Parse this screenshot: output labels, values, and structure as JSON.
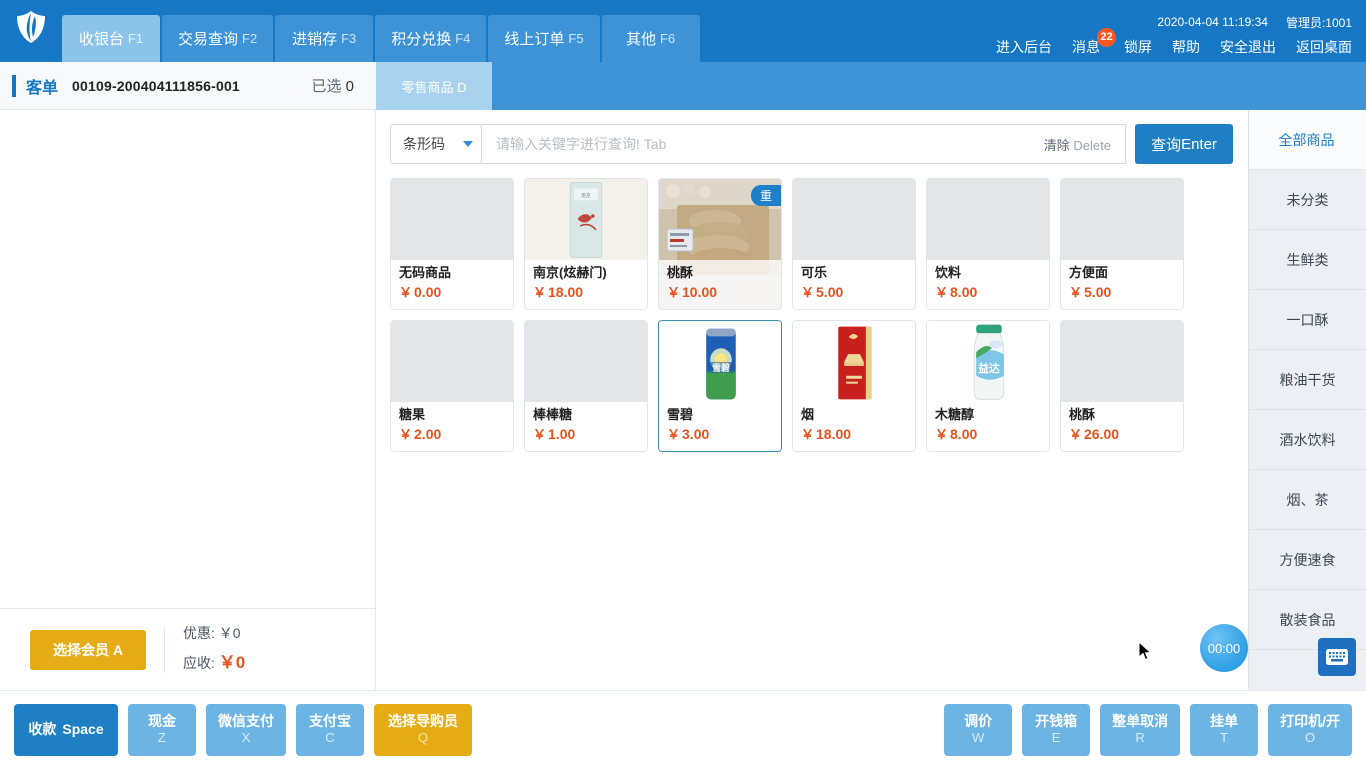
{
  "header": {
    "logo_icon": "shield-logo-icon",
    "tabs": [
      {
        "label": "收银台",
        "key": "F1",
        "active": true
      },
      {
        "label": "交易查询",
        "key": "F2",
        "active": false
      },
      {
        "label": "进销存",
        "key": "F3",
        "active": false
      },
      {
        "label": "积分兑换",
        "key": "F4",
        "active": false
      },
      {
        "label": "线上订单",
        "key": "F5",
        "active": false
      },
      {
        "label": "其他",
        "key": "F6",
        "active": false
      }
    ],
    "datetime": "2020-04-04 11:19:34",
    "operator": "管理员:1001",
    "links": [
      {
        "label": "进入后台",
        "name": "enter-backend"
      },
      {
        "label": "消息",
        "name": "messages",
        "badge": "22"
      },
      {
        "label": "锁屏",
        "name": "lock-screen"
      },
      {
        "label": "帮助",
        "name": "help"
      },
      {
        "label": "安全退出",
        "name": "safe-logout"
      },
      {
        "label": "返回桌面",
        "name": "back-to-desktop"
      }
    ]
  },
  "subheader": {
    "order_label": "客单",
    "order_no": "00109-200404111856-001",
    "selected_label": "已选",
    "selected_count": "0",
    "retail_tab": "零售商品 D"
  },
  "search": {
    "type_value": "条形码",
    "placeholder": "请输入关键字进行查询! Tab",
    "input_value": "",
    "clear_label": "清除",
    "clear_key": "Delete",
    "query_label": "查询",
    "query_key": "Enter"
  },
  "products": [
    {
      "name": "无码商品",
      "price": "0.00",
      "currency": "￥",
      "style": "blank",
      "badge": null,
      "selected": false,
      "image": null
    },
    {
      "name": "南京(炫赫门)",
      "price": "18.00",
      "currency": "￥",
      "style": "photo",
      "badge": null,
      "selected": false,
      "image": "cigarette-pack-teal"
    },
    {
      "name": "桃酥",
      "price": "10.00",
      "currency": "￥",
      "style": "fullbleed",
      "badge": "重",
      "selected": false,
      "image": "pastry-tray-photo"
    },
    {
      "name": "可乐",
      "price": "5.00",
      "currency": "￥",
      "style": "blank",
      "badge": null,
      "selected": false,
      "image": null
    },
    {
      "name": "饮料",
      "price": "8.00",
      "currency": "￥",
      "style": "blank",
      "badge": null,
      "selected": false,
      "image": null
    },
    {
      "name": "方便面",
      "price": "5.00",
      "currency": "￥",
      "style": "blank",
      "badge": null,
      "selected": false,
      "image": null
    },
    {
      "name": "糖果",
      "price": "2.00",
      "currency": "￥",
      "style": "blank",
      "badge": null,
      "selected": false,
      "image": null
    },
    {
      "name": "棒棒糖",
      "price": "1.00",
      "currency": "￥",
      "style": "blank",
      "badge": null,
      "selected": false,
      "image": null
    },
    {
      "name": "雪碧",
      "price": "3.00",
      "currency": "￥",
      "style": "photo",
      "badge": null,
      "selected": true,
      "image": "sprite-can"
    },
    {
      "name": "烟",
      "price": "18.00",
      "currency": "￥",
      "style": "photo",
      "badge": null,
      "selected": false,
      "image": "red-cigarette-pack"
    },
    {
      "name": "木糖醇",
      "price": "8.00",
      "currency": "￥",
      "style": "photo",
      "badge": null,
      "selected": false,
      "image": "xylitol-bottle"
    },
    {
      "name": "桃酥",
      "price": "26.00",
      "currency": "￥",
      "style": "blank",
      "badge": null,
      "selected": false,
      "image": null
    }
  ],
  "categories": [
    {
      "label": "全部商品",
      "active": true
    },
    {
      "label": "未分类",
      "active": false
    },
    {
      "label": "生鲜类",
      "active": false
    },
    {
      "label": "一口酥",
      "active": false
    },
    {
      "label": "粮油干货",
      "active": false
    },
    {
      "label": "酒水饮料",
      "active": false
    },
    {
      "label": "烟、茶",
      "active": false
    },
    {
      "label": "方便速食",
      "active": false
    },
    {
      "label": "散装食品",
      "active": false
    }
  ],
  "overlay": {
    "timer": "00:00",
    "keyboard_icon": "keyboard-icon"
  },
  "order_footer": {
    "member_label": "选择会员 A",
    "discount_label": "优惠:",
    "discount_value": "￥0",
    "receivable_label": "应收:",
    "receivable_currency": "￥",
    "receivable_value": "0"
  },
  "actions_left": [
    {
      "label": "收款",
      "key": "Space",
      "style": "primary"
    },
    {
      "label": "现金",
      "key": "Z",
      "style": "light"
    },
    {
      "label": "微信支付",
      "key": "X",
      "style": "light"
    },
    {
      "label": "支付宝",
      "key": "C",
      "style": "light"
    },
    {
      "label": "选择导购员",
      "key": "Q",
      "style": "yellow"
    }
  ],
  "actions_right": [
    {
      "label": "调价",
      "key": "W"
    },
    {
      "label": "开钱箱",
      "key": "E"
    },
    {
      "label": "整单取消",
      "key": "R"
    },
    {
      "label": "挂单",
      "key": "T"
    },
    {
      "label": "打印机/开",
      "key": "O"
    }
  ],
  "colors": {
    "brand_blue": "#1677c4",
    "tab_blue": "#3d93d6",
    "active_tab": "#8cc3e9",
    "price_orange": "#e8521f",
    "yellow": "#e5ac16",
    "badge_red": "#ff5722"
  }
}
